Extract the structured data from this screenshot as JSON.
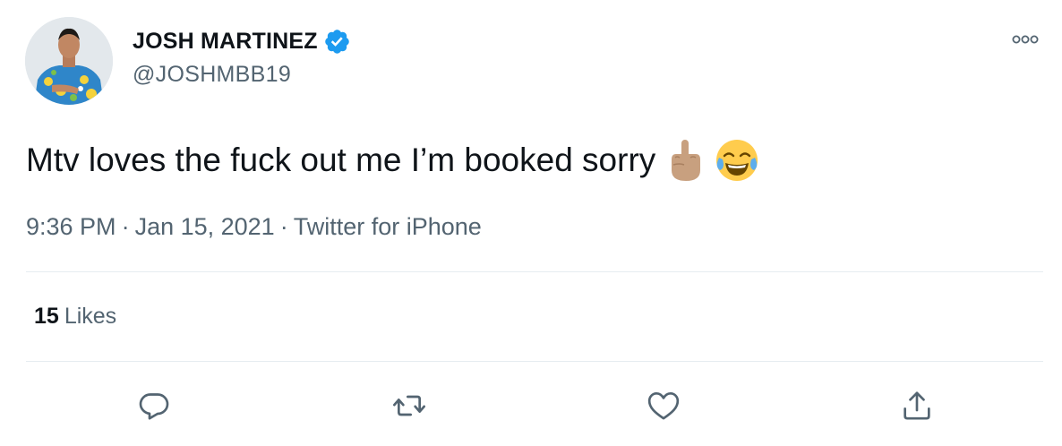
{
  "author": {
    "display_name": "JOSH MARTINEZ",
    "handle": "@JOSHMBB19",
    "verified": true,
    "verified_icon": "verified-badge-icon"
  },
  "tweet": {
    "text": "Mtv loves the fuck out me I’m booked sorry",
    "emojis": [
      "middle-finger-emoji",
      "tears-of-joy-emoji"
    ]
  },
  "meta": {
    "time": "9:36 PM",
    "separator": "·",
    "date": "Jan 15, 2021",
    "source": "Twitter for iPhone"
  },
  "stats": {
    "likes_count": "15",
    "likes_label": "Likes"
  },
  "actions": {
    "reply_icon": "reply-icon",
    "retweet_icon": "retweet-icon",
    "like_icon": "heart-icon",
    "share_icon": "share-icon"
  },
  "colors": {
    "text_primary": "#0f1419",
    "text_secondary": "#536471",
    "verified_blue": "#1d9bf0",
    "divider": "#e6ecf0"
  }
}
